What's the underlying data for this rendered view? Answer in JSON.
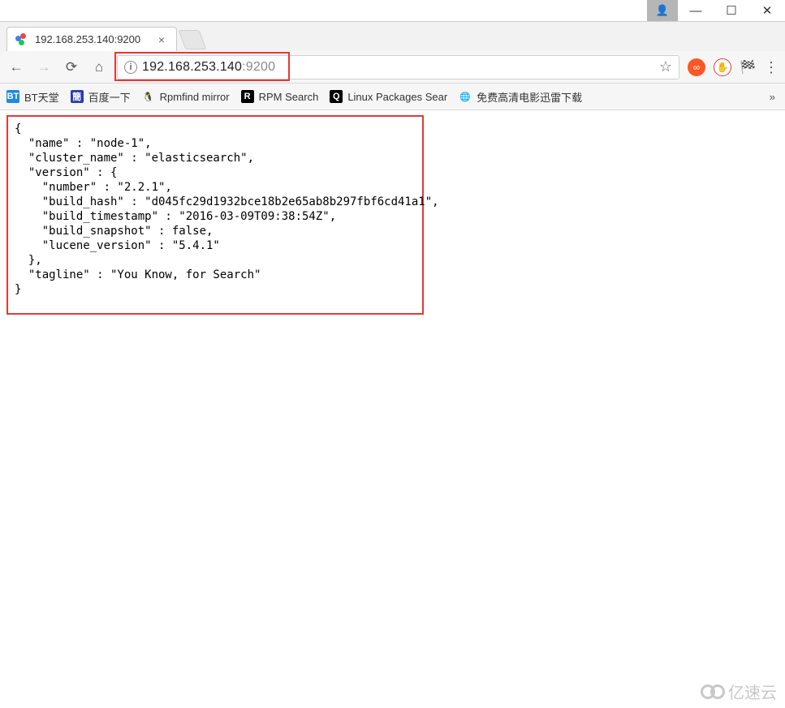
{
  "window": {
    "minimize_glyph": "—",
    "maximize_glyph": "☐",
    "close_glyph": "✕",
    "user_glyph": "👤"
  },
  "tab": {
    "title": "192.168.253.140:9200",
    "close_glyph": "×"
  },
  "nav": {
    "back_glyph": "←",
    "forward_glyph": "→",
    "reload_glyph": "⟳",
    "home_glyph": "⌂",
    "info_glyph": "i",
    "url_host": "192.168.253.140",
    "url_port": ":9200",
    "star_glyph": "☆",
    "menu_glyph": "⋮",
    "more_bookmarks_glyph": "»",
    "ext1_glyph": "∞",
    "ext2_glyph": "✋",
    "ext3_glyph": "🏁"
  },
  "bookmarks": [
    {
      "icon_class": "bkm-bt",
      "icon_text": "BT",
      "label": "BT天堂"
    },
    {
      "icon_class": "bkm-baidu",
      "icon_text": "簡",
      "label": "百度一下"
    },
    {
      "icon_class": "bkm-tux",
      "icon_text": "🐧",
      "label": "Rpmfind mirror"
    },
    {
      "icon_class": "bkm-rpm",
      "icon_text": "R",
      "label": "RPM Search"
    },
    {
      "icon_class": "bkm-linux",
      "icon_text": "Q",
      "label": "Linux Packages Sear"
    },
    {
      "icon_class": "bkm-globe",
      "icon_text": "🌐",
      "label": "免费高清电影迅雷下载"
    }
  ],
  "json_response": {
    "name": "node-1",
    "cluster_name": "elasticsearch",
    "version": {
      "number": "2.2.1",
      "build_hash": "d045fc29d1932bce18b2e65ab8b297fbf6cd41a1",
      "build_timestamp": "2016-03-09T09:38:54Z",
      "build_snapshot": "false",
      "lucene_version": "5.4.1"
    },
    "tagline": "You Know, for Search"
  },
  "json_lines": [
    "{",
    "  \"name\" : \"node-1\",",
    "  \"cluster_name\" : \"elasticsearch\",",
    "  \"version\" : {",
    "    \"number\" : \"2.2.1\",",
    "    \"build_hash\" : \"d045fc29d1932bce18b2e65ab8b297fbf6cd41a1\",",
    "    \"build_timestamp\" : \"2016-03-09T09:38:54Z\",",
    "    \"build_snapshot\" : false,",
    "    \"lucene_version\" : \"5.4.1\"",
    "  },",
    "  \"tagline\" : \"You Know, for Search\"",
    "}"
  ],
  "watermark": "亿速云"
}
